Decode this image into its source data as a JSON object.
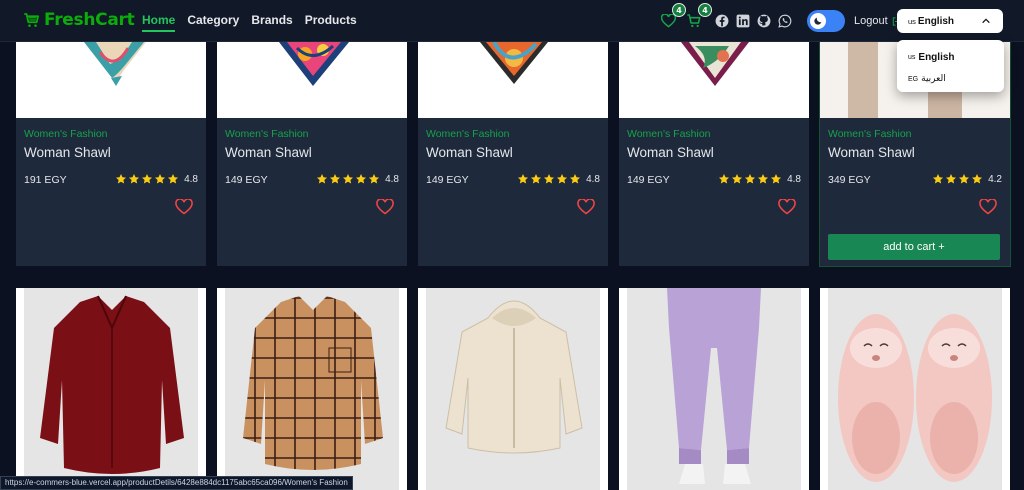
{
  "navbar": {
    "brand": "FreshCart",
    "links": [
      {
        "label": "Home",
        "active": true
      },
      {
        "label": "Category",
        "active": false
      },
      {
        "label": "Brands",
        "active": false
      },
      {
        "label": "Products",
        "active": false
      }
    ],
    "wishlist_count": "4",
    "cart_count": "4",
    "social_icons": [
      "facebook-icon",
      "linkedin-icon",
      "github-icon",
      "whatsapp-icon"
    ],
    "logout_label": "Logout",
    "language": {
      "selected_code": "us",
      "selected_label": "English",
      "options": [
        {
          "code": "us",
          "label": "English"
        },
        {
          "code": "EG",
          "label": "العربية"
        }
      ]
    }
  },
  "products_row1": [
    {
      "category": "Women's Fashion",
      "title": "Woman Shawl",
      "price": "191 EGY",
      "rating": "4.8",
      "stars": 5
    },
    {
      "category": "Women's Fashion",
      "title": "Woman Shawl",
      "price": "149 EGY",
      "rating": "4.8",
      "stars": 5
    },
    {
      "category": "Women's Fashion",
      "title": "Woman Shawl",
      "price": "149 EGY",
      "rating": "4.8",
      "stars": 5
    },
    {
      "category": "Women's Fashion",
      "title": "Woman Shawl",
      "price": "149 EGY",
      "rating": "4.8",
      "stars": 5
    },
    {
      "category": "Women's Fashion",
      "title": "Woman Shawl",
      "price": "349 EGY",
      "rating": "4.2",
      "stars": 4,
      "add_to_cart": "add to cart +"
    }
  ],
  "status_url": "https://e-commers-blue.vercel.app/productDetils/6428e884dc1175abc65ca096/Women's Fashion",
  "colors": {
    "accent": "#16a34a",
    "card_bg": "#1e293b",
    "page_bg": "#0b1120",
    "star": "#facc15",
    "heart": "#ef4444",
    "button": "#198754"
  }
}
